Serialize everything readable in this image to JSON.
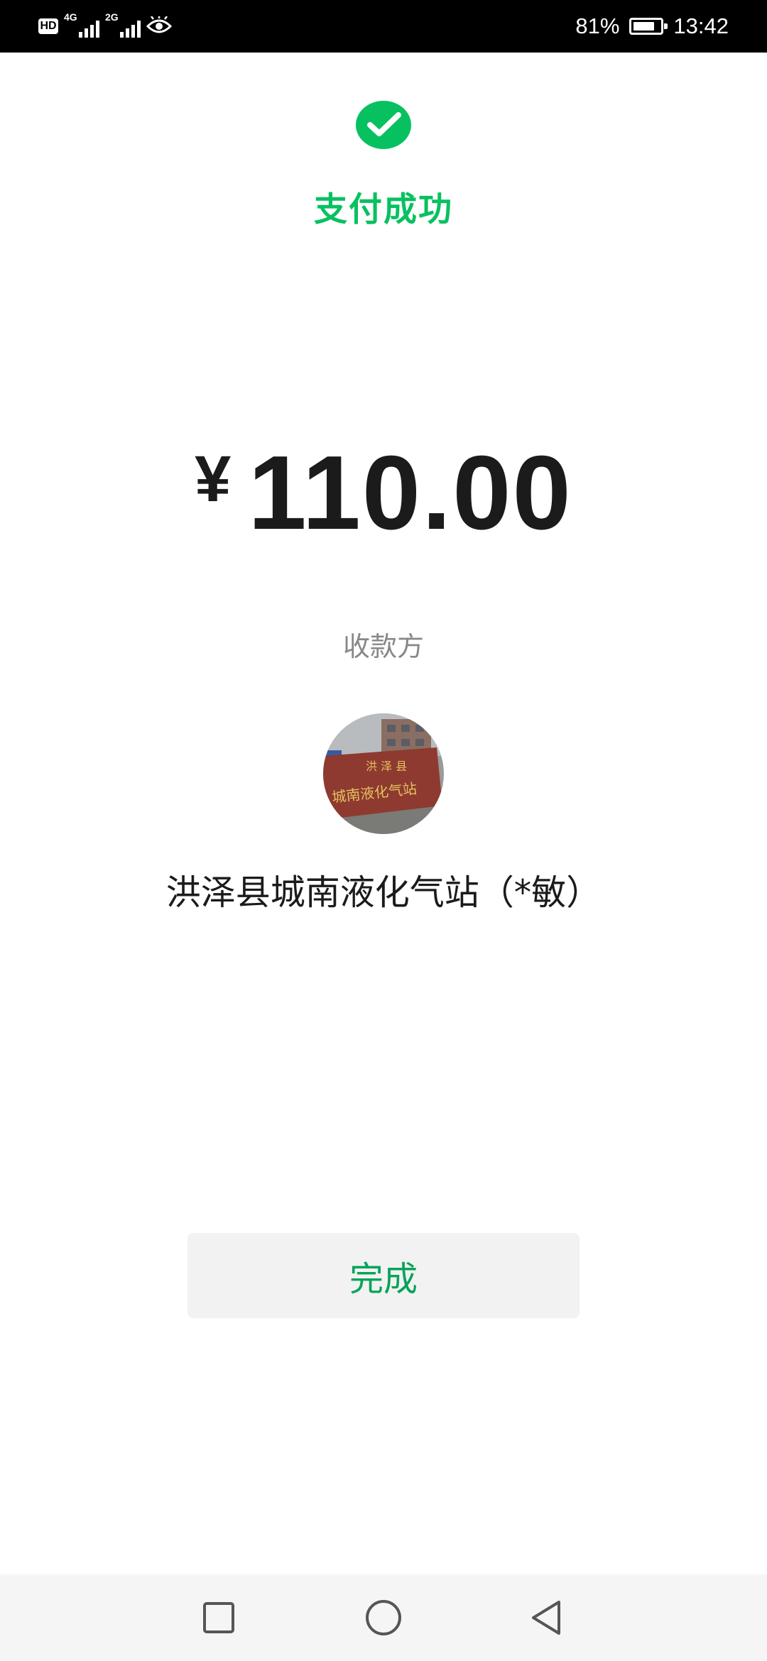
{
  "status_bar": {
    "hd_label": "HD",
    "network_1": "4G",
    "network_2": "2G",
    "battery_percent": "81%",
    "battery_level": 0.81,
    "time": "13:42",
    "icons": [
      "hd-icon",
      "signal-4g-icon",
      "signal-2g-icon",
      "eye-icon",
      "battery-icon"
    ]
  },
  "header": {
    "icon": "wechat-pay-check-icon",
    "title": "支付成功"
  },
  "payment": {
    "currency_symbol": "¥",
    "amount": "110.00"
  },
  "payee": {
    "label": "收款方",
    "avatar": "payee-avatar-photo",
    "name": "洪泽县城南液化气站（*敏）"
  },
  "actions": {
    "done_label": "完成"
  },
  "navigation": {
    "icons": [
      "recent-apps-icon",
      "home-icon",
      "back-icon"
    ]
  },
  "colors": {
    "accent_green": "#07c160",
    "button_text_green": "#07a35a",
    "amount_text": "#1b1b1b",
    "label_gray": "#888888",
    "button_bg": "#f2f2f2",
    "status_bar_bg": "#000000",
    "nav_bar_bg": "#f5f5f5"
  }
}
